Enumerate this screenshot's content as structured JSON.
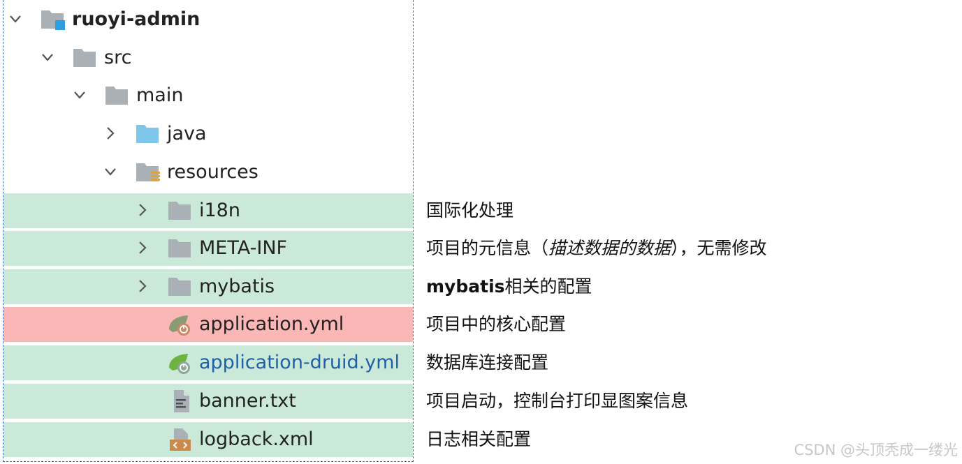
{
  "tree": {
    "items": [
      {
        "label": "ruoyi-admin",
        "icon": "module-folder-icon",
        "arrow": "chevron-down-icon"
      },
      {
        "label": "src",
        "icon": "folder-icon",
        "arrow": "chevron-down-icon"
      },
      {
        "label": "main",
        "icon": "folder-icon",
        "arrow": "chevron-down-icon"
      },
      {
        "label": "java",
        "icon": "source-folder-icon",
        "arrow": "chevron-right-icon"
      },
      {
        "label": "resources",
        "icon": "resources-folder-icon",
        "arrow": "chevron-down-icon"
      },
      {
        "label": "i18n",
        "icon": "folder-icon",
        "arrow": "chevron-right-icon"
      },
      {
        "label": "META-INF",
        "icon": "folder-icon",
        "arrow": "chevron-right-icon"
      },
      {
        "label": "mybatis",
        "icon": "folder-icon",
        "arrow": "chevron-right-icon"
      },
      {
        "label": "application.yml",
        "icon": "spring-yml-icon"
      },
      {
        "label": "application-druid.yml",
        "icon": "spring-yml-icon"
      },
      {
        "label": "banner.txt",
        "icon": "text-file-icon"
      },
      {
        "label": "logback.xml",
        "icon": "xml-file-icon"
      }
    ]
  },
  "notes": {
    "i18n": "国际化处理",
    "meta_inf_pre": "项目的元信息（",
    "meta_inf_ital": "描述数据的数据",
    "meta_inf_post": "），无需修改",
    "mybatis_bold": "mybatis",
    "mybatis_rest": "相关的配置",
    "application": "项目中的核心配置",
    "druid": "数据库连接配置",
    "banner": "项目启动，控制台打印显图案信息",
    "logback": "日志相关配置"
  },
  "watermark": "CSDN @头顶秃成一缕光",
  "colors": {
    "highlight_green": "#cbe9d8",
    "highlight_red": "#fbb6b6",
    "folder_gray": "#a9b0b6",
    "folder_blue": "#7fc7ea",
    "link_blue": "#1f5fa8",
    "spring_green": "#6db33f"
  }
}
